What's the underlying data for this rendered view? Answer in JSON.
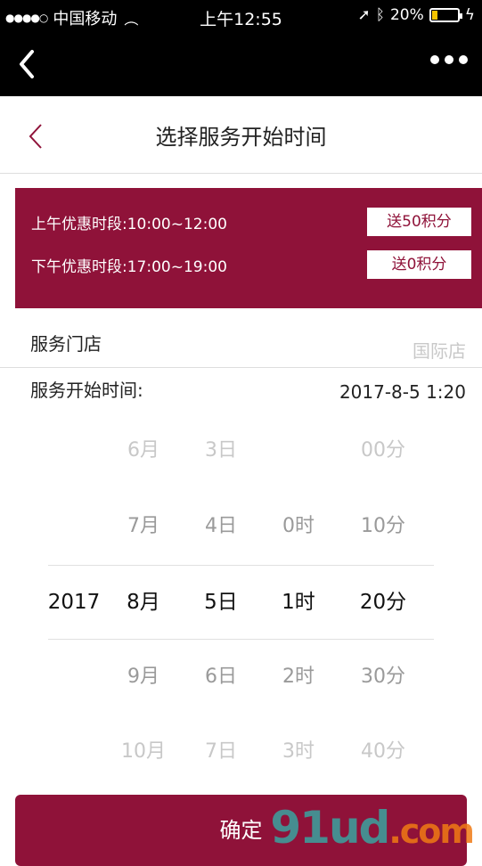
{
  "status_bar": {
    "carrier": "中国移动",
    "time": "上午12:55",
    "battery": "20%",
    "battery_level": 0.2
  },
  "page": {
    "title": "选择服务开始时间"
  },
  "promo": {
    "morning": "上午优惠时段:10:00~12:00",
    "morning_badge": "送50积分",
    "afternoon": "下午优惠时段:17:00~19:00",
    "afternoon_badge": "送0积分"
  },
  "store": {
    "label": "服务门店",
    "value": "国际店"
  },
  "start_time": {
    "label": "服务开始时间:",
    "value": "2017-8-5 1:20"
  },
  "picker": {
    "year": [
      "2017"
    ],
    "month": [
      "6月",
      "7月",
      "8月",
      "9月",
      "10月"
    ],
    "day": [
      "3日",
      "4日",
      "5日",
      "6日",
      "7日"
    ],
    "hour": [
      "0时",
      "1时",
      "2时",
      "3时"
    ],
    "minute": [
      "00分",
      "10分",
      "20分",
      "30分",
      "40分"
    ]
  },
  "confirm_label": "确定",
  "watermark": {
    "main": "91ud",
    "suffix": ".com"
  },
  "colors": {
    "accent": "#8f1239",
    "nav_bg": "#000000"
  }
}
